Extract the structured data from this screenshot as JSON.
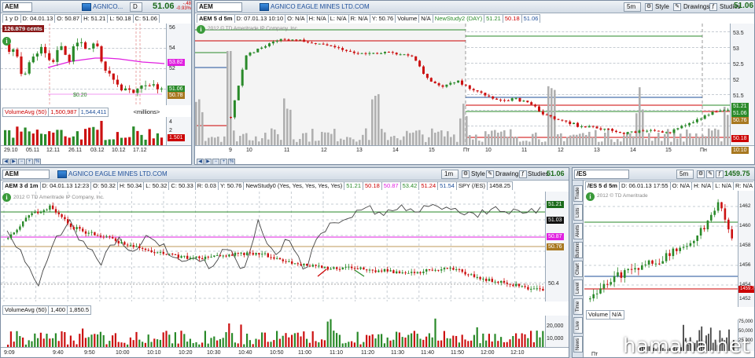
{
  "colors": {
    "up": "#2a8a2a",
    "down": "#cc1111",
    "ma": "#e020e0",
    "link": "#1e4f9a",
    "price": "#1a6a1a"
  },
  "panels": {
    "topleft": {
      "symbol": "AEM",
      "company": "AGNICO...",
      "period": "1 y D",
      "period_btn": "D",
      "price": "51.06",
      "change": "-.48",
      "change_pct": "-0.93%",
      "stats": {
        "date": "D: 04.01.13",
        "open": "O: 50.87",
        "high": "H: 51.21",
        "low": "L: 50.18",
        "close": "C: 51.06"
      },
      "price_badge": "126.879 cents",
      "copyright": "2012 © TDA",
      "y_ticks": [
        "56",
        "54",
        "52",
        "50"
      ],
      "tags": {
        "ma": "53.82",
        "last": "51.06",
        "low": "50.78"
      },
      "volume": {
        "label": "VolumeAvg (50)",
        "v1": "1,500,987",
        "v2": "1,544,411",
        "unit": "<millions>",
        "y_ticks": [
          "4",
          "2"
        ],
        "tag": "1.501"
      },
      "x_ticks": [
        "29.10",
        "05.11",
        "12.11",
        "26.11",
        "03.12",
        "10.12",
        "17.12"
      ],
      "annotation": "$0.20"
    },
    "topright": {
      "symbol": "AEM",
      "company": "AGNICO EAGLE MINES LTD.COM",
      "period_btn": "5m",
      "style": "Style",
      "drawings": "Drawings",
      "studies": "Studies",
      "price": "51.06",
      "change": "-.48",
      "change_pct": "-0.93%",
      "stats": {
        "chart": "AEM 5 d 5m",
        "date": "D: 07.01.13 10:10",
        "open": "O: N/A",
        "high": "H: N/A",
        "low": "L: N/A",
        "range": "R: N/A",
        "y": "Y: 50.76",
        "volume": "Volume",
        "volume_val": "N/A",
        "study": "NewStudy2 (DAY)",
        "s1": "51.21",
        "s2": "50.18",
        "s3": "51.06"
      },
      "copyright": "2012 © TD Ameritrade IP Company, Inc.",
      "y_ticks": [
        "53.5",
        "53",
        "52.5",
        "52",
        "51.5",
        "51",
        "50.5",
        "50"
      ],
      "tags": {
        "t1": "51.21",
        "t2": "51.06",
        "t3": "50.76",
        "t4": "50.18",
        "time": "10:10"
      },
      "x_ticks": [
        "9",
        "10",
        "11",
        "12",
        "13",
        "14",
        "15",
        "Пт",
        "10",
        "11",
        "12",
        "13",
        "14",
        "15",
        "Пн"
      ]
    },
    "bottomleft": {
      "symbol": "AEM",
      "company": "AGNICO EAGLE MINES LTD.COM",
      "period_btn": "1m",
      "style": "Style",
      "drawings": "Drawings",
      "studies": "Studies",
      "price": "51.06",
      "change": "-.48",
      "change_pct": "-0.93%",
      "stats": {
        "chart": "AEM 3 d 1m",
        "date": "D: 04.01.13 12:23",
        "open": "O: 50.32",
        "high": "H: 50.34",
        "low": "L: 50.32",
        "close": "C: 50.33",
        "range": "R: 0.03",
        "y": "Y: 50.76",
        "study": "NewStudy0 (Yes, Yes, Yes, Yes, Yes)",
        "s1": "51.21",
        "s2": "50.18",
        "s3": "50.87",
        "s4": "53.42",
        "s5": "51.24",
        "s6": "51.54",
        "spy": "SPY (/ES)",
        "spy_val": "1458.25"
      },
      "copyright": "2012 © TD Ameritrade IP Company, Inc.",
      "y_ticks": [
        "50.4"
      ],
      "tags": {
        "t1": "51.21",
        "t2": "51.03",
        "t3": "50.87",
        "t4": "50.76"
      },
      "volume": {
        "label": "VolumeAvg (50)",
        "v1": "1,400",
        "v2": "1,850.5",
        "y_ticks": [
          "20,000",
          "10,000"
        ]
      },
      "x_ticks": [
        "9:09",
        "9:40",
        "9:50",
        "10:00",
        "10:10",
        "10:20",
        "10:30",
        "10:40",
        "10:50",
        "11:00",
        "11:10",
        "11:20",
        "11:30",
        "11:40",
        "11:50",
        "12:00",
        "12:10"
      ]
    },
    "bottomright": {
      "symbol": "/ES",
      "period_btn": "5m",
      "price": "1459.75",
      "change": "-.75",
      "change_pct": "-0.05%",
      "stats": {
        "chart": "/ES 5 d 5m",
        "date": "D: 06.01.13 17:55",
        "open": "O: N/A",
        "high": "H: N/A",
        "low": "L: N/A",
        "range": "R: N/A"
      },
      "copyright": "2012 © TD Ameritrade",
      "y_ticks": [
        "1462",
        "1460",
        "1458",
        "1456",
        "1454",
        "1452"
      ],
      "tags": {
        "t1": "1459.75"
      },
      "volume": {
        "label": "Volume",
        "value": "N/A",
        "y_ticks": [
          "75,000",
          "50,000",
          "25,000"
        ]
      },
      "x_ticks": [
        "Пт"
      ],
      "side_tabs": [
        "Trade",
        "Lists",
        "Alerts",
        "Buttons",
        "Chart",
        "Level",
        "Time",
        "Live",
        "News"
      ]
    }
  },
  "watermark": "hamana.net"
}
